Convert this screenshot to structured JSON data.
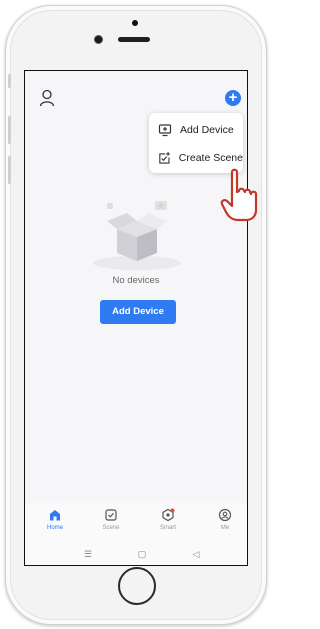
{
  "menu": {
    "items": [
      {
        "label": "Add Device",
        "icon": "add-device-icon"
      },
      {
        "label": "Create Scene",
        "icon": "create-scene-icon"
      }
    ]
  },
  "empty_state": {
    "message": "No devices",
    "button_label": "Add Device"
  },
  "tabs": [
    {
      "label": "Home",
      "icon": "home-icon",
      "active": true
    },
    {
      "label": "Scene",
      "icon": "scene-icon",
      "active": false
    },
    {
      "label": "Smart",
      "icon": "smart-icon",
      "active": false,
      "badge": true
    },
    {
      "label": "Me",
      "icon": "me-icon",
      "active": false
    }
  ],
  "colors": {
    "accent": "#2f7cf2",
    "badge": "#e74c3c",
    "hand_pointer": "#c0392b"
  }
}
